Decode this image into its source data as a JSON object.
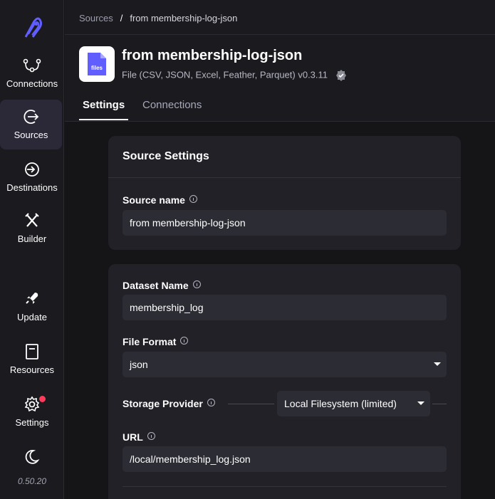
{
  "sidebar": {
    "items": [
      {
        "label": "Connections",
        "icon": "connections-icon"
      },
      {
        "label": "Sources",
        "icon": "sources-icon",
        "active": true
      },
      {
        "label": "Destinations",
        "icon": "destinations-icon"
      },
      {
        "label": "Builder",
        "icon": "builder-icon"
      },
      {
        "label": "Update",
        "icon": "rocket-icon"
      },
      {
        "label": "Resources",
        "icon": "book-icon"
      },
      {
        "label": "Settings",
        "icon": "gear-icon",
        "notification": true
      },
      {
        "label": "",
        "icon": "moon-icon"
      }
    ],
    "version": "0.50.20"
  },
  "breadcrumb": {
    "link": "Sources",
    "separator": "/",
    "current": "from membership-log-json"
  },
  "header": {
    "icon_text": "files",
    "title": "from membership-log-json",
    "subtitle": "File (CSV, JSON, Excel, Feather, Parquet) v0.3.11",
    "tabs": [
      {
        "label": "Settings",
        "active": true
      },
      {
        "label": "Connections",
        "active": false
      }
    ]
  },
  "source_settings": {
    "title": "Source Settings",
    "source_name_label": "Source name",
    "source_name_value": "from membership-log-json"
  },
  "config": {
    "dataset_label": "Dataset Name",
    "dataset_value": "membership_log",
    "format_label": "File Format",
    "format_value": "json",
    "storage_label": "Storage Provider",
    "storage_value": "Local Filesystem (limited)",
    "url_label": "URL",
    "url_value": "/local/membership_log.json"
  },
  "colors": {
    "accent": "#615eff",
    "notification": "#ff3b5b",
    "sidebar_active": "#2b2938"
  }
}
